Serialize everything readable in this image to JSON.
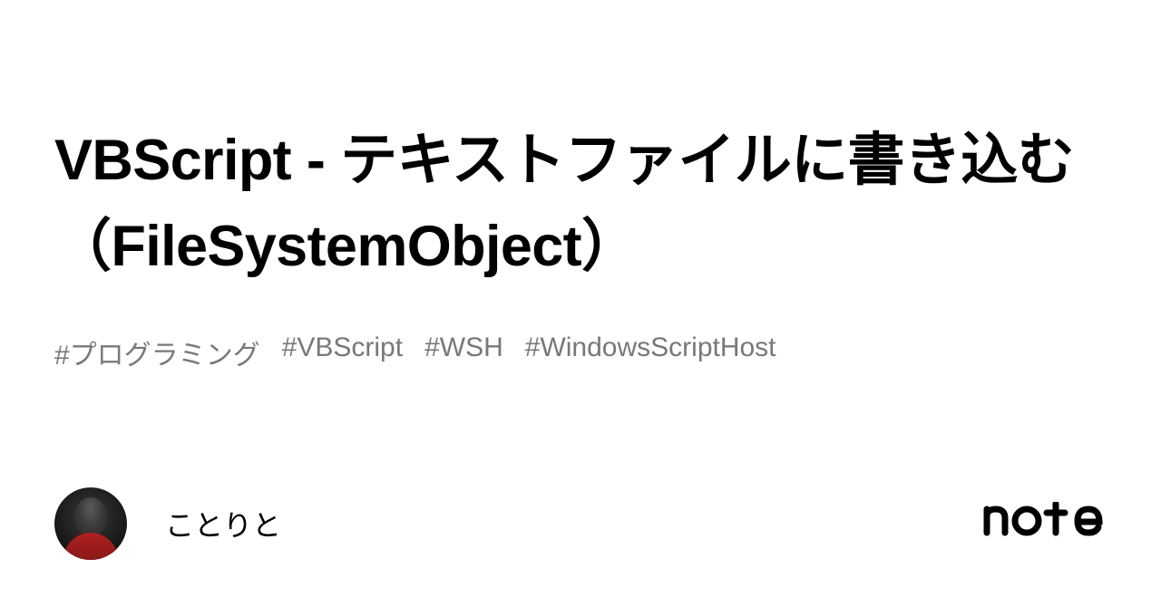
{
  "article": {
    "title": "VBScript - テキストファイルに書き込む（FileSystemObject）"
  },
  "tags": [
    "#プログラミング",
    "#VBScript",
    "#WSH",
    "#WindowsScriptHost"
  ],
  "author": {
    "name": "ことりと"
  },
  "brand": {
    "name": "note"
  }
}
